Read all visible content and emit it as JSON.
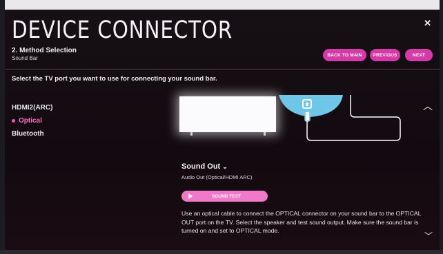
{
  "header": {
    "title": "DEVICE CONNECTOR",
    "step": "2. Method Selection",
    "substep": "Sound Bar",
    "close_icon": "close-icon"
  },
  "nav_buttons": {
    "back_to_main": "BACK TO MAIN",
    "previous": "PREVIOUS",
    "next": "NEXT"
  },
  "instruction": "Select the TV port you want to use for connecting your sound bar.",
  "ports": [
    {
      "label": "HDMI2(ARC)",
      "selected": false
    },
    {
      "label": "Optical",
      "selected": true
    },
    {
      "label": "Bluetooth",
      "selected": false
    }
  ],
  "sound_out": {
    "label": "Sound Out",
    "value": "Audio Out (Optical/HDMI ARC)",
    "chevron_icon": "chevron-down-icon"
  },
  "sound_test": {
    "label": "SOUND TEST",
    "icon": "play-icon"
  },
  "description": "Use an optical cable to connect the OPTICAL connector on your sound bar to the OPTICAL OUT port on the TV. Select the speaker and test sound output. Make sure the sound bar is turned on and set to OPTICAL mode.",
  "colors": {
    "accent": "#d53aa7",
    "accent_light": "#f07ac8",
    "selected_text": "#ff6dc0",
    "cable": "#6fc7e8"
  }
}
